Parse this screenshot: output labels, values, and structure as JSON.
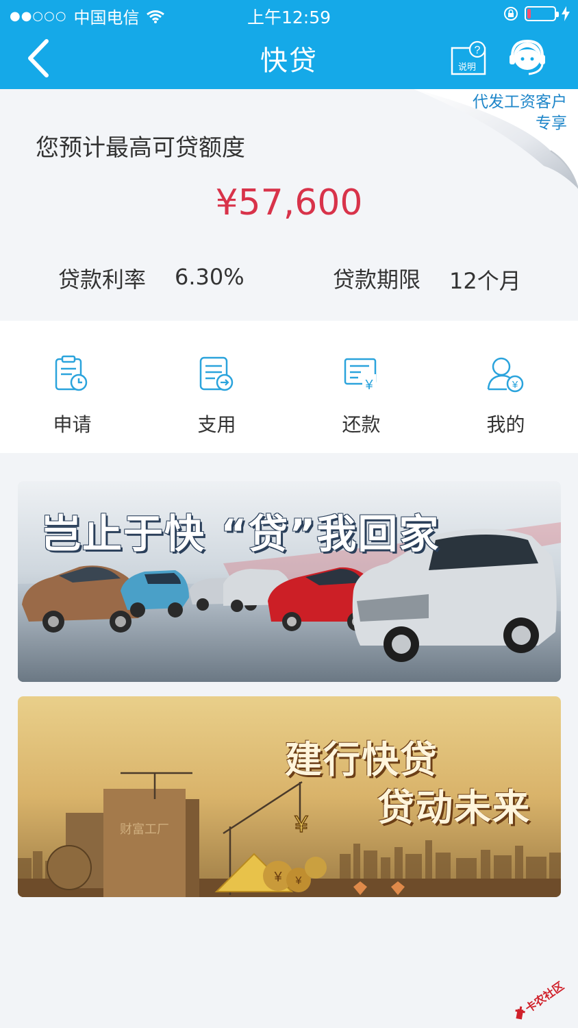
{
  "status_bar": {
    "signal": "●●○○○",
    "carrier": "中国电信",
    "time": "上午12:59",
    "battery_level": 0.12
  },
  "header": {
    "title": "快贷",
    "help_label": "说明"
  },
  "quota": {
    "badge_line1": "代发工资客户",
    "badge_line2": "专享",
    "title": "您预计最高可贷额度",
    "amount": "¥57,600",
    "rate_label": "贷款利率",
    "rate_value": "6.30%",
    "term_label": "贷款期限",
    "term_value": "12个月"
  },
  "actions": [
    {
      "label": "申请",
      "icon": "apply-icon"
    },
    {
      "label": "支用",
      "icon": "draw-icon"
    },
    {
      "label": "还款",
      "icon": "repay-icon"
    },
    {
      "label": "我的",
      "icon": "my-icon"
    }
  ],
  "banners": {
    "car": {
      "headline": "岂止于快 “贷”我回家"
    },
    "ccb": {
      "line1": "建行快贷",
      "line2": "贷动未来",
      "building_sign": "财富工厂"
    }
  },
  "watermark": "卡农社区",
  "colors": {
    "header": "#15a9e8",
    "amount": "#d8334a",
    "icon": "#2aa3dc",
    "badge_text": "#1e86c9"
  }
}
